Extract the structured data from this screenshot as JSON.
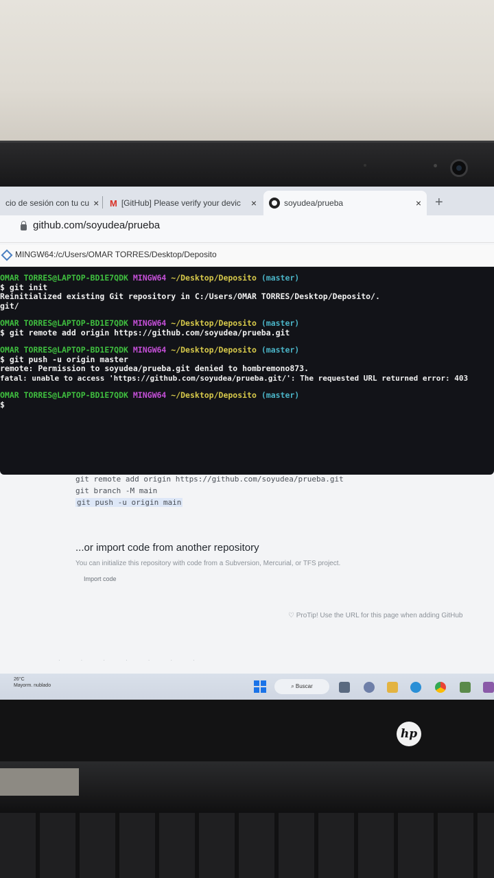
{
  "browser": {
    "tabs": [
      {
        "label": "cio de sesión con tu cu",
        "close": "×"
      },
      {
        "icon": "M",
        "label": "[GitHub] Please verify your devic",
        "close": "×"
      },
      {
        "label": "soyudea/prueba",
        "close": "×"
      }
    ],
    "new_tab": "+",
    "url": "github.com/soyudea/prueba"
  },
  "terminal": {
    "title": "MINGW64:/c/Users/OMAR TORRES/Desktop/Deposito",
    "blocks": [
      {
        "prompt": {
          "user": "OMAR TORRES@LAPTOP-BD1E7QDK",
          "shell": "MINGW64",
          "path": "~/Desktop/Deposito",
          "branch": "(master)"
        },
        "command": "$ git init",
        "output": [
          "Reinitialized existing Git repository in C:/Users/OMAR TORRES/Desktop/Deposito/.",
          "git/"
        ]
      },
      {
        "prompt": {
          "user": "OMAR TORRES@LAPTOP-BD1E7QDK",
          "shell": "MINGW64",
          "path": "~/Desktop/Deposito",
          "branch": "(master)"
        },
        "command": "$ git remote add origin https://github.com/soyudea/prueba.git",
        "output": []
      },
      {
        "prompt": {
          "user": "OMAR TORRES@LAPTOP-BD1E7QDK",
          "shell": "MINGW64",
          "path": "~/Desktop/Deposito",
          "branch": "(master)"
        },
        "command": "$ git push -u origin master",
        "output": [
          "remote: Permission to soyudea/prueba.git denied to hombremono873.",
          "fatal: unable to access 'https://github.com/soyudea/prueba.git/': The requested URL returned error: 403"
        ]
      },
      {
        "prompt": {
          "user": "OMAR TORRES@LAPTOP-BD1E7QDK",
          "shell": "MINGW64",
          "path": "~/Desktop/Deposito",
          "branch": "(master)"
        },
        "command": "$",
        "output": []
      }
    ]
  },
  "github_page": {
    "code_lines": [
      "git remote add origin https://github.com/soyudea/prueba.git",
      "git branch -M main",
      "git push -u origin main"
    ],
    "import_title": "...or import code from another repository",
    "import_desc": "You can initialize this repository with code from a Subversion, Mercurial, or TFS project.",
    "import_button": "Import code",
    "protip": "♡ ProTip! Use the URL for this page when adding GitHub"
  },
  "taskbar": {
    "weather_temp": "26°C",
    "weather_desc": "Mayorm. nublado",
    "search_label": "⌕ Buscar"
  },
  "laptop": {
    "brand": "hp"
  }
}
